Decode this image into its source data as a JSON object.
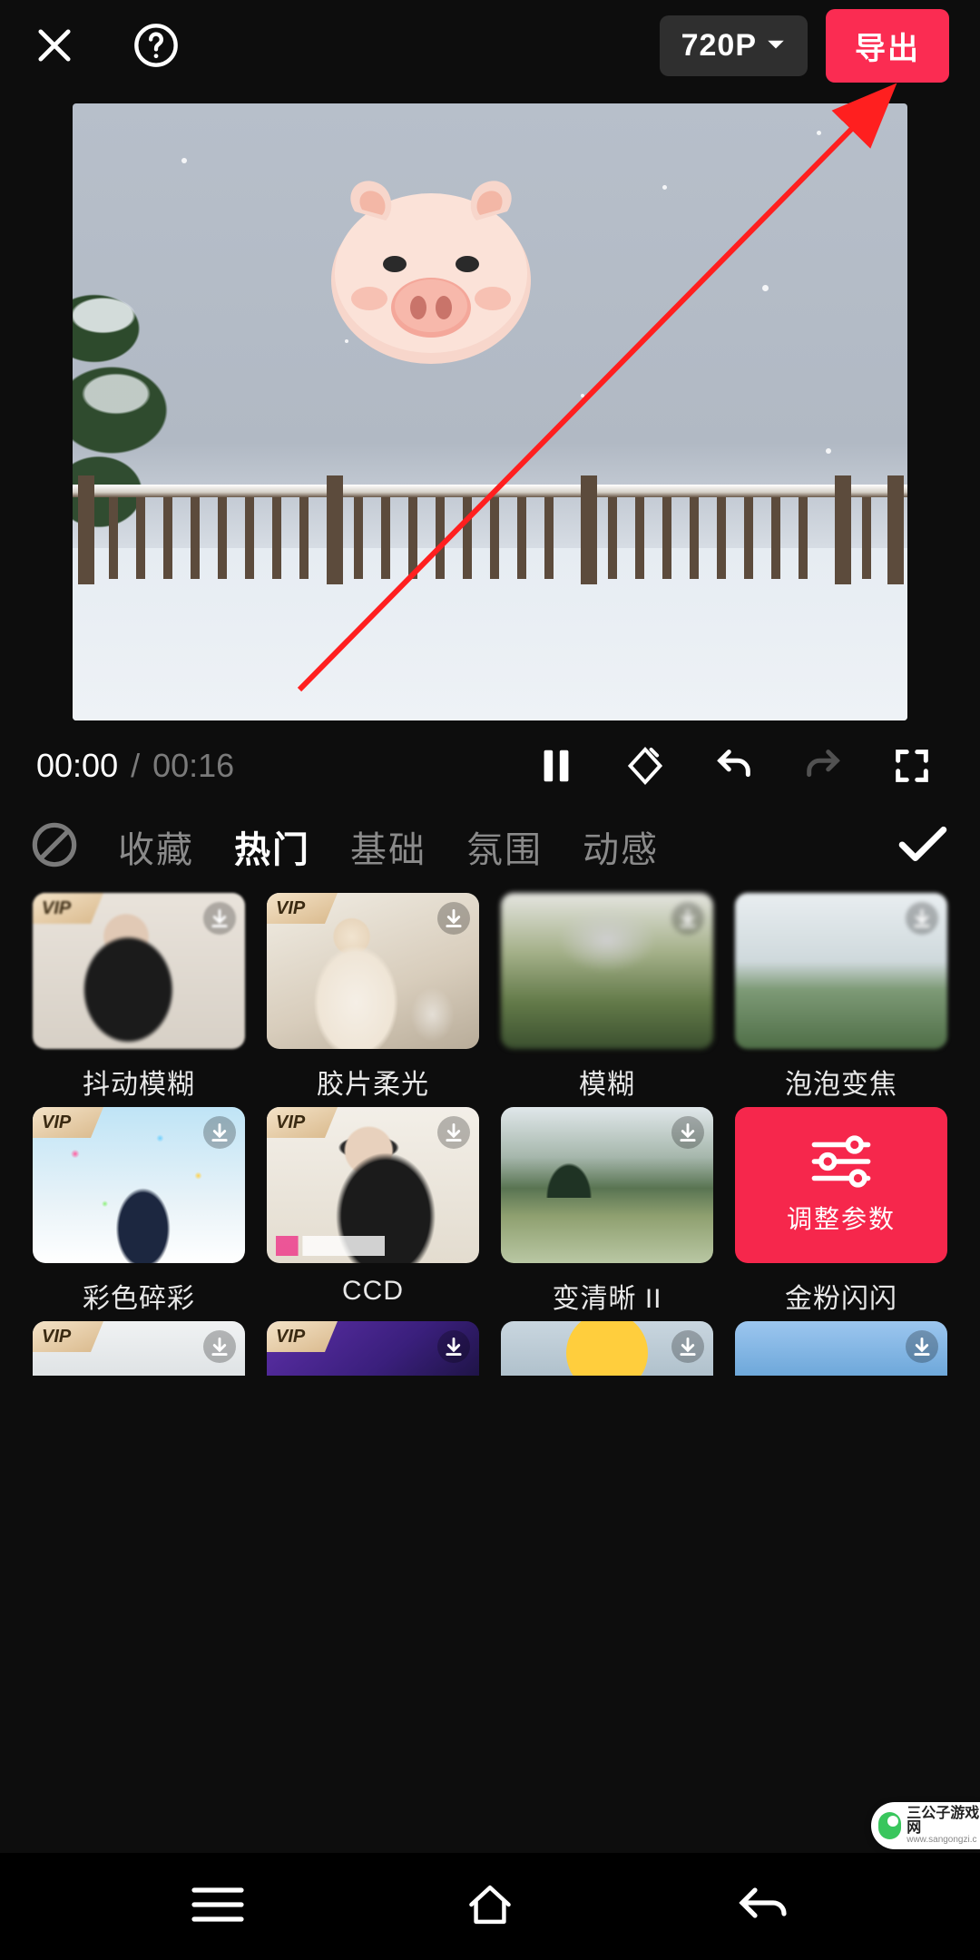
{
  "topbar": {
    "resolution": "720P",
    "export_label": "导出"
  },
  "playback": {
    "current": "00:00",
    "duration": "00:16"
  },
  "categories": {
    "fav": "收藏",
    "hot": "热门",
    "basic": "基础",
    "mood": "氛围",
    "dynamic": "动感"
  },
  "effects": {
    "r1": [
      {
        "name": "抖动模糊",
        "vip": true
      },
      {
        "name": "胶片柔光",
        "vip": true
      },
      {
        "name": "模糊",
        "vip": false
      },
      {
        "name": "泡泡变焦",
        "vip": false
      }
    ],
    "r2": [
      {
        "name": "彩色碎彩",
        "vip": true
      },
      {
        "name": "CCD",
        "vip": true
      },
      {
        "name": "变清晰 II",
        "vip": false
      },
      {
        "name": "金粉闪闪",
        "adjust": true,
        "adjust_label": "调整参数"
      }
    ],
    "r3": [
      {
        "vip": true
      },
      {
        "vip": true
      },
      {
        "vip": false
      },
      {
        "vip": false
      }
    ]
  },
  "watermark": {
    "line1": "三公子游戏网",
    "line2": "www.sangongzi.c"
  }
}
